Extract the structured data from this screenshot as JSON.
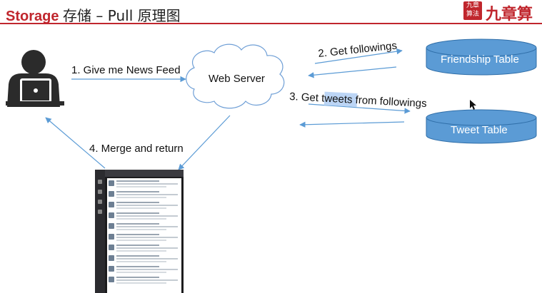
{
  "title": {
    "brand": "Storage",
    "cjk": "存储",
    "rest": " – Pull 原理图"
  },
  "logo": {
    "seal_text": "九章算法",
    "script_text": "九章算"
  },
  "nodes": {
    "user": "user-silhouette",
    "server": "Web Server",
    "friendship": "Friendship Table",
    "tweet": "Tweet Table",
    "feed": "news-feed-screenshot"
  },
  "steps": {
    "s1": "1. Give me News Feed",
    "s2": "2. Get followings",
    "s3_pre": "3. Get ",
    "s3_hl": "tweets",
    "s3_post": " from followings",
    "s4": "4. Merge and return"
  },
  "colors": {
    "accent": "#c0262d",
    "arrow": "#5b9bd5",
    "db_fill": "#5b9bd5",
    "db_stroke": "#2f6ea8"
  }
}
